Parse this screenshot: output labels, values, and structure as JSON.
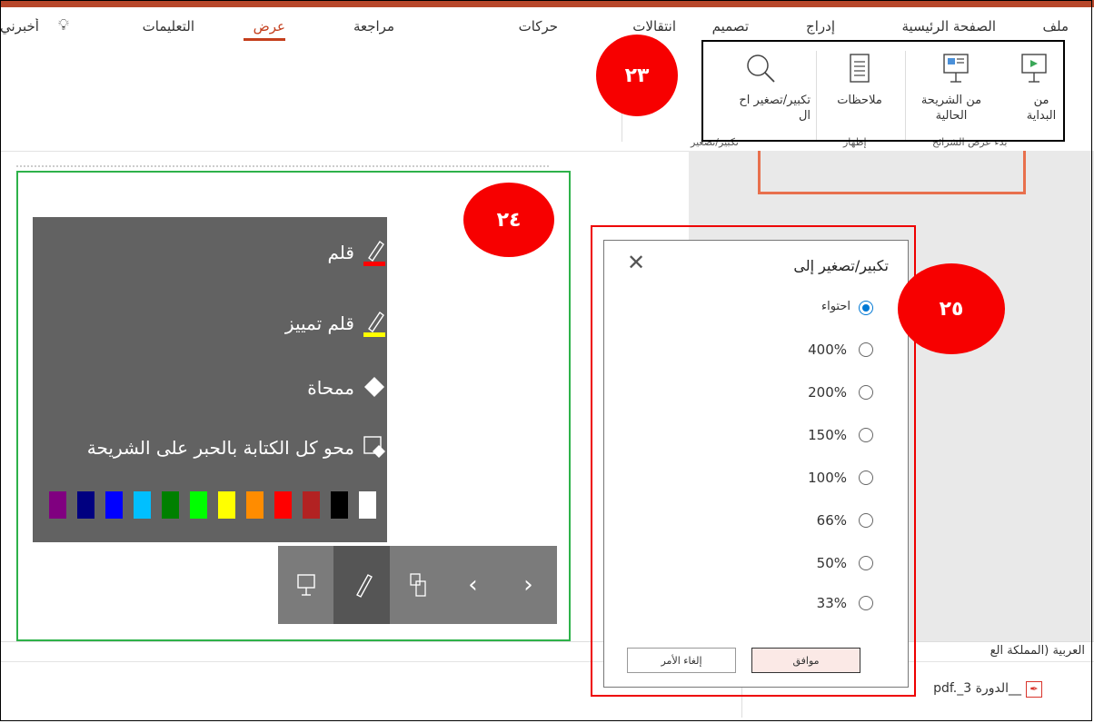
{
  "tabs": [
    {
      "label": "ملف",
      "active": false
    },
    {
      "label": "الصفحة الرئيسية",
      "active": false
    },
    {
      "label": "إدراج",
      "active": false
    },
    {
      "label": "تصميم",
      "active": false
    },
    {
      "label": "انتقالات",
      "active": false
    },
    {
      "label": "حركات",
      "active": false
    },
    {
      "label": "مراجعة",
      "active": false
    },
    {
      "label": "عرض",
      "active": true
    },
    {
      "label": "التعليمات",
      "active": false
    },
    {
      "label": "أخبرني",
      "active": false
    }
  ],
  "ribbon": {
    "from_beginning_line1": "من",
    "from_beginning_line2": "البداية",
    "from_current_line1": "من الشريحة",
    "from_current_line2": "الحالية",
    "notes": "ملاحظات",
    "zoom": "تكبير/تصغير اح",
    "zoom_line2": "ال",
    "group_slideshow": "بدء عرض الشرائح",
    "group_show": "إظهار",
    "group_zoom": "تكبير/تصغير"
  },
  "badges": {
    "b23": "٢٣",
    "b24": "٢٤",
    "b25": "٢٥"
  },
  "ink_menu": {
    "pen": "قلم",
    "highlighter": "قلم تمييز",
    "eraser": "ممحاة",
    "erase_all": "محو كل الكتابة بالحبر على الشريحة",
    "colors": [
      "#ffffff",
      "#000000",
      "#b22222",
      "#ff0000",
      "#ff8c00",
      "#ffff00",
      "#00ff00",
      "#008000",
      "#00bfff",
      "#0000ff",
      "#000080",
      "#800080"
    ]
  },
  "zoom_dialog": {
    "title": "تكبير/تصغير إلى",
    "options": [
      {
        "label": "احتواء",
        "selected": true
      },
      {
        "label": "400%",
        "selected": false
      },
      {
        "label": "200%",
        "selected": false
      },
      {
        "label": "150%",
        "selected": false
      },
      {
        "label": "100%",
        "selected": false
      },
      {
        "label": "66%",
        "selected": false
      },
      {
        "label": "50%",
        "selected": false
      },
      {
        "label": "33%",
        "selected": false
      }
    ],
    "ok": "موافق",
    "cancel": "إلغاء الأمر"
  },
  "status": {
    "language": "العربية (المملكة الع",
    "file": "pdf._الدورة 3__"
  },
  "colors": {
    "accent": "#c43e1c",
    "badge": "#f70000",
    "ok_bg": "#fbe9e6"
  }
}
